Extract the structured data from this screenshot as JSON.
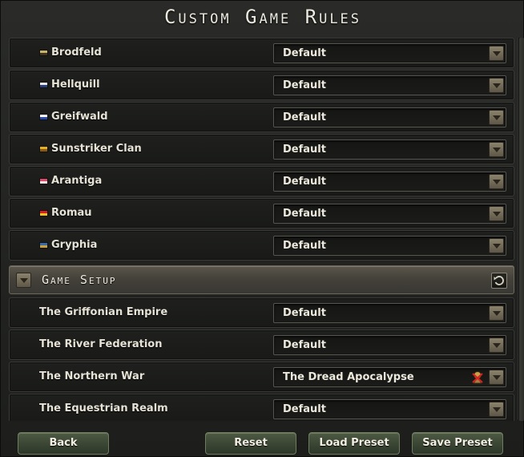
{
  "window": {
    "title": "Custom Game Rules"
  },
  "rules": [
    {
      "label": "Brodfeld",
      "flag_colors": [
        "#c9b26a",
        "#3d3420"
      ],
      "value": "Default"
    },
    {
      "label": "Hellquill",
      "flag_colors": [
        "#e8e8e8",
        "#2a3f7a"
      ],
      "value": "Default"
    },
    {
      "label": "Greifwald",
      "flag_colors": [
        "#ffffff",
        "#2b4aa8"
      ],
      "value": "Default"
    },
    {
      "label": "Sunstriker Clan",
      "flag_colors": [
        "#e6b020",
        "#8a5a10"
      ],
      "value": "Default"
    },
    {
      "label": "Arantiga",
      "flag_colors": [
        "#d84a6a",
        "#f0e0e0"
      ],
      "value": "Default"
    },
    {
      "label": "Romau",
      "flag_colors": [
        "#d42020",
        "#f0c020"
      ],
      "value": "Default"
    },
    {
      "label": "Gryphia",
      "flag_colors": [
        "#3a6aa8",
        "#c8a040"
      ],
      "value": "Default"
    }
  ],
  "section": {
    "title": "Game Setup"
  },
  "setup_rules": [
    {
      "label": "The Griffonian Empire",
      "value": "Default",
      "warning": false
    },
    {
      "label": "The River Federation",
      "value": "Default",
      "warning": false
    },
    {
      "label": "The Northern War",
      "value": "The Dread Apocalypse",
      "warning": true
    },
    {
      "label": "The Equestrian Realm",
      "value": "Default",
      "warning": false
    }
  ],
  "footer": {
    "back": "Back",
    "reset": "Reset",
    "load_preset": "Load Preset",
    "save_preset": "Save Preset"
  },
  "icons": {
    "dropdown": "chevron-down-icon",
    "reset_section": "reset-icon",
    "warning": "warning-icon"
  }
}
